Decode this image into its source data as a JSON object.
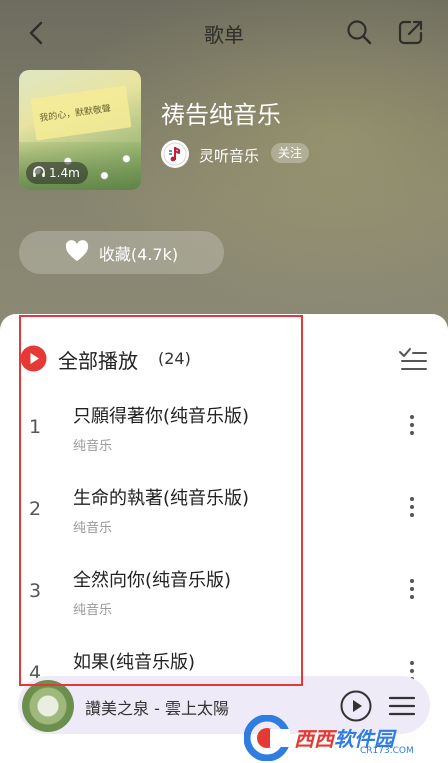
{
  "header": {
    "title": "歌单"
  },
  "playlist": {
    "name": "祷告纯音乐",
    "play_count": "1.4m",
    "cover_text": "我的心，默默敬聲",
    "creator": "灵听音乐",
    "follow_label": "关注",
    "favorite_label": "收藏(4.7k)"
  },
  "list": {
    "play_all_label": "全部播放",
    "count": "(24)",
    "songs": [
      {
        "index": "1",
        "title": "只願得著你(纯音乐版)",
        "subtitle": "纯音乐"
      },
      {
        "index": "2",
        "title": "生命的執著(纯音乐版)",
        "subtitle": "纯音乐"
      },
      {
        "index": "3",
        "title": "全然向你(纯音乐版)",
        "subtitle": "纯音乐"
      },
      {
        "index": "4",
        "title": "如果(纯音乐版)",
        "subtitle": ""
      }
    ]
  },
  "player": {
    "now_playing": "讚美之泉 - 雲上太陽"
  },
  "watermark": {
    "text_red": "西西",
    "text_blue": "软件园",
    "url": "CR173.COM"
  },
  "colors": {
    "accent_red": "#e23a3a",
    "play_red": "#e53935",
    "brand_blue": "#2f7de1"
  },
  "icons": [
    "back-icon",
    "search-icon",
    "share-icon",
    "headphones-icon",
    "heart-icon",
    "play-circle-icon",
    "multiselect-icon",
    "more-vertical-icon",
    "play-icon",
    "queue-icon"
  ]
}
